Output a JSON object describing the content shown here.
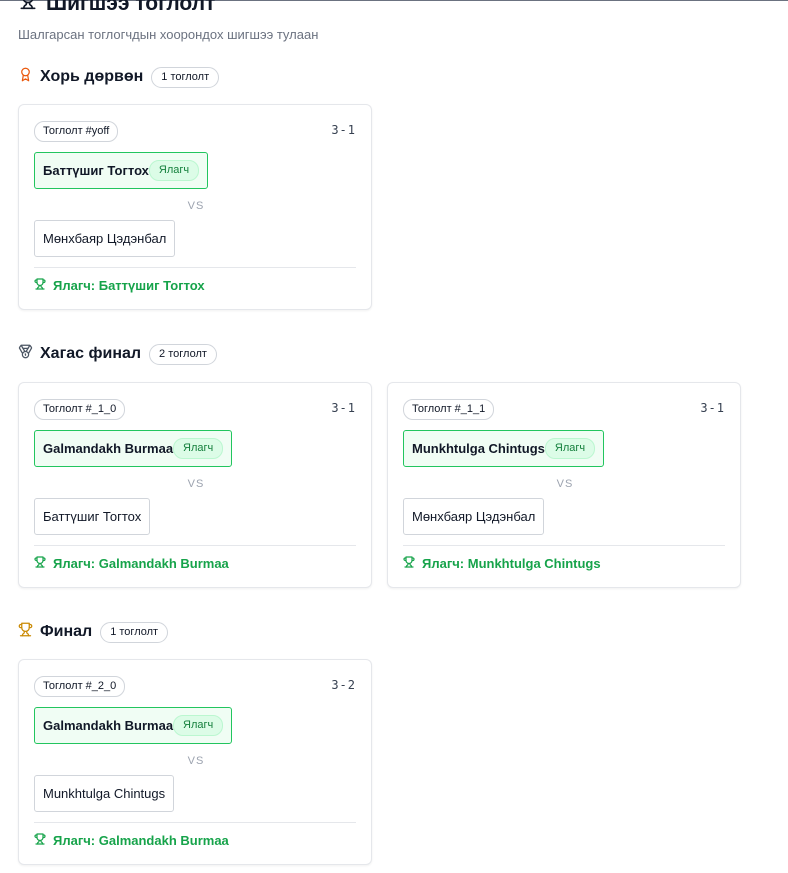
{
  "page": {
    "title": "Шигшээ тоглолт",
    "subtitle": "Шалгарсан тоглогчдын хоорондох шигшээ тулаан",
    "title_icon": "trophy-icon"
  },
  "rounds": [
    {
      "name": "Хорь дөрвөн",
      "count": "1 тоглолт",
      "icon": "award-ribbon-icon",
      "icon_color": "#ea580c",
      "matches": [
        {
          "tag": "Тоглолт #yoff",
          "score": "3-1",
          "player1": "Баттүшиг Тогтох",
          "player2": "Мөнхбаяр Цэдэнбал",
          "winner_badge": "Ялагч",
          "vs": "VS",
          "winner_text": "Ялагч: Баттүшиг Тогтох"
        }
      ]
    },
    {
      "name": "Хагас финал",
      "count": "2 тоглолт",
      "icon": "medal-icon",
      "icon_color": "#4b5563",
      "matches": [
        {
          "tag": "Тоглолт #_1_0",
          "score": "3-1",
          "player1": "Galmandakh Burmaa",
          "player2": "Баттүшиг Тогтох",
          "winner_badge": "Ялагч",
          "vs": "VS",
          "winner_text": "Ялагч: Galmandakh Burmaa"
        },
        {
          "tag": "Тоглолт #_1_1",
          "score": "3-1",
          "player1": "Munkhtulga Chintugs",
          "player2": "Мөнхбаяр Цэдэнбал",
          "winner_badge": "Ялагч",
          "vs": "VS",
          "winner_text": "Ялагч: Munkhtulga Chintugs"
        }
      ]
    },
    {
      "name": "Финал",
      "count": "1 тоглолт",
      "icon": "trophy-icon",
      "icon_color": "#ca8a04",
      "matches": [
        {
          "tag": "Тоглолт #_2_0",
          "score": "3-2",
          "player1": "Galmandakh Burmaa",
          "player2": "Munkhtulga Chintugs",
          "winner_badge": "Ялагч",
          "vs": "VS",
          "winner_text": "Ялагч: Galmandakh Burmaa"
        }
      ]
    }
  ],
  "colors": {
    "winner_green": "#16a34a",
    "winner_border": "#22c55e",
    "winner_bg": "#f0fdf4"
  }
}
